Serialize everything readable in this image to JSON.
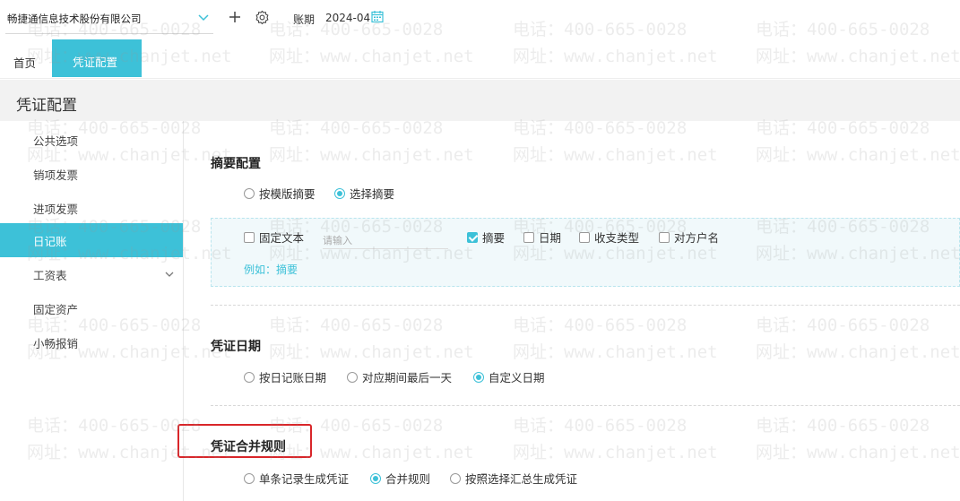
{
  "topbar": {
    "company": "畅捷通信息技术股份有限公司",
    "period_label": "账期",
    "period_value": "2024-04"
  },
  "tabs": {
    "home": "首页",
    "active": "凭证配置"
  },
  "page": {
    "title": "凭证配置"
  },
  "sidebar": {
    "items": [
      {
        "label": "公共选项"
      },
      {
        "label": "销项发票"
      },
      {
        "label": "进项发票"
      },
      {
        "label": "日记账"
      },
      {
        "label": "工资表"
      },
      {
        "label": "固定资产"
      },
      {
        "label": "小畅报销"
      }
    ],
    "active_index": 3
  },
  "summary": {
    "title": "摘要配置",
    "options": [
      "按模版摘要",
      "选择摘要"
    ],
    "selected": 1,
    "fixed_text_label": "固定文本",
    "input_placeholder": "请输入",
    "fields": [
      {
        "label": "摘要",
        "checked": true
      },
      {
        "label": "日期",
        "checked": false
      },
      {
        "label": "收支类型",
        "checked": false
      },
      {
        "label": "对方户名",
        "checked": false
      }
    ],
    "example": "例如：摘要"
  },
  "date": {
    "title": "凭证日期",
    "options": [
      "按日记账日期",
      "对应期间最后一天",
      "自定义日期"
    ],
    "selected": 2
  },
  "merge": {
    "title": "凭证合并规则",
    "options": [
      "单条记录生成凭证",
      "合并规则",
      "按照选择汇总生成凭证"
    ],
    "selected": 1
  },
  "watermark": {
    "phone": "电话：400-665-0028",
    "site": "网址：www.chanjet.net"
  },
  "colors": {
    "accent": "#3dc1d8",
    "highlight": "#d9262a"
  }
}
